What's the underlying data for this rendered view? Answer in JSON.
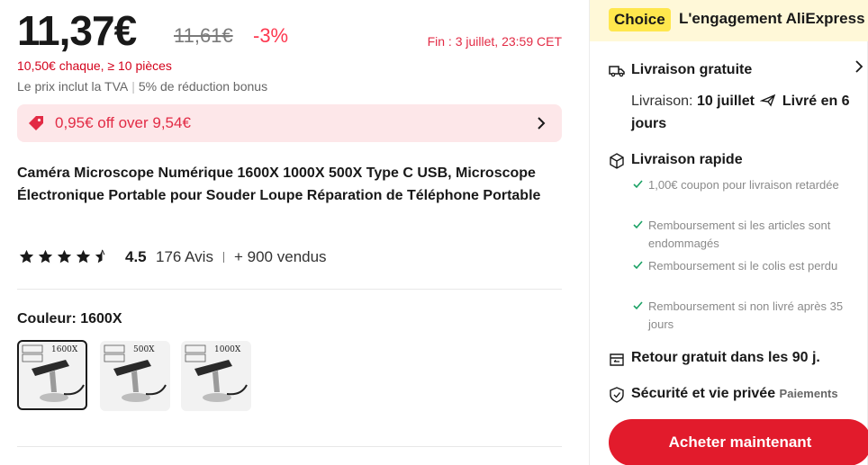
{
  "price": {
    "current": "11,37€",
    "original": "11,61€",
    "discount": "-3%",
    "end": "Fin : 3 juillet, 23:59 CET",
    "bulk": "10,50€ chaque, ≥ 10 pièces",
    "vat": "Le prix inclut la TVA",
    "bonus": "5% de réduction bonus"
  },
  "coupon": {
    "text": "0,95€ off over 9,54€",
    "icon": "tag-icon"
  },
  "product": {
    "title": "Caméra Microscope Numérique 1600X 1000X 500X Type C USB, Microscope Électronique Portable pour Souder Loupe Réparation de Téléphone Portable"
  },
  "rating": {
    "value": "4.5",
    "stars": 4.5,
    "reviews": "176 Avis",
    "sold": "+ 900 vendus"
  },
  "variant": {
    "label": "Couleur: 1600X",
    "options": [
      {
        "tag": "1600X",
        "selected": true
      },
      {
        "tag": "500X",
        "selected": false
      },
      {
        "tag": "1000X",
        "selected": false
      }
    ]
  },
  "sidebar": {
    "choice_badge": "Choice",
    "choice_text": "L'engagement AliExpress",
    "shipping_title": "Livraison gratuite",
    "shipping_label": "Livraison:",
    "shipping_date": "10 juillet",
    "shipping_delivered": "Livré en 6 jours",
    "fast_title": "Livraison rapide",
    "fast_items": [
      "1,00€ coupon pour livraison retardée",
      "Remboursement si les articles sont endommagés",
      "Remboursement si le colis est perdu",
      "Remboursement si non livré après 35 jours"
    ],
    "return_title": "Retour gratuit dans les 90 j.",
    "security_title": "Sécurité et vie privée",
    "security_sub": "Paiements",
    "buy_button": "Acheter maintenant"
  },
  "colors": {
    "red": "#e21b2c",
    "price_red": "#fd384f",
    "coupon_bg": "#fde7e9",
    "choice_bg": "#fff8d8",
    "choice_badge": "#ffe74d",
    "check_green": "#1aa164"
  }
}
